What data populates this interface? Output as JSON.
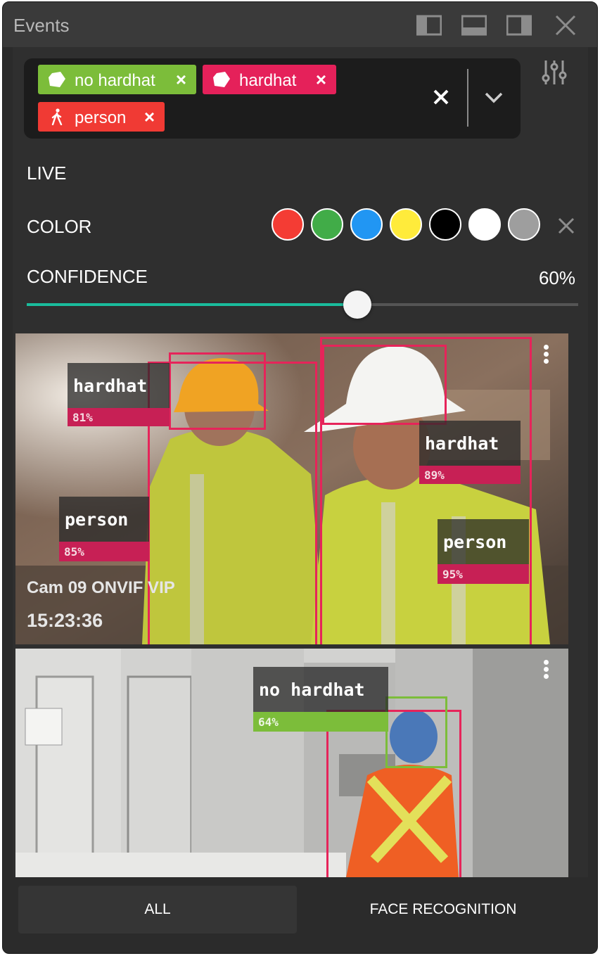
{
  "window": {
    "title": "Events"
  },
  "filters": {
    "chips": [
      {
        "label": "no hardhat",
        "color": "#7cbd3a",
        "icon": "hardhat-icon"
      },
      {
        "label": "hardhat",
        "color": "#e5215a",
        "icon": "hardhat-icon"
      },
      {
        "label": "person",
        "color": "#f03a34",
        "icon": "person-walking-icon"
      }
    ],
    "remove_glyph": "×"
  },
  "live": {
    "label": "LIVE"
  },
  "color_filter": {
    "label": "COLOR",
    "swatches": [
      "#f43c34",
      "#41ac48",
      "#2196f3",
      "#ffeb3b",
      "#000000",
      "#ffffff",
      "#9e9e9e"
    ]
  },
  "confidence": {
    "label": "CONFIDENCE",
    "value_text": "60%",
    "value": 0.6
  },
  "feeds": [
    {
      "camera": "Cam 09 ONVIF VIP",
      "time": "15:23:36",
      "detections": [
        {
          "name": "hardhat",
          "confidence": "81%"
        },
        {
          "name": "person",
          "confidence": "85%"
        },
        {
          "name": "hardhat",
          "confidence": "89%"
        },
        {
          "name": "person",
          "confidence": "95%"
        }
      ]
    },
    {
      "detections": [
        {
          "name": "no hardhat",
          "confidence": "64%"
        }
      ]
    }
  ],
  "tabs": [
    {
      "label": "ALL"
    },
    {
      "label": "FACE RECOGNITION"
    }
  ]
}
